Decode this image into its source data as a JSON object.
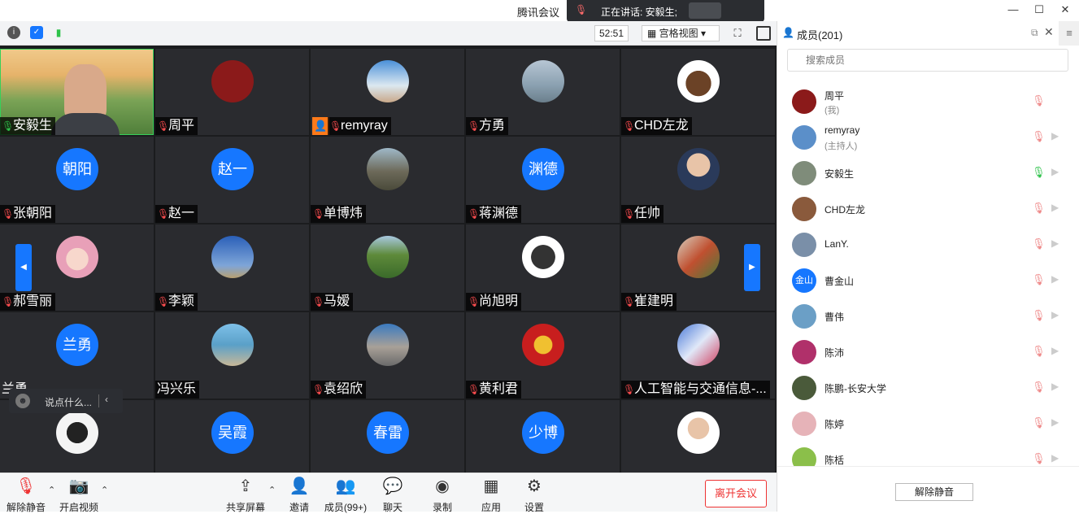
{
  "app": {
    "title": "腾讯会议"
  },
  "speaking": {
    "text": "正在讲话: 安毅生;"
  },
  "window": {
    "minimize": "—",
    "maximize": "☐",
    "close": "✕"
  },
  "toolbar": {
    "timer": "52:51",
    "view_label": "宫格视图"
  },
  "tiles": [
    {
      "name": "安毅生",
      "mic": "on"
    },
    {
      "name": "周平",
      "mic": "off"
    },
    {
      "name": "remyray",
      "mic": "off"
    },
    {
      "name": "方勇",
      "mic": "off"
    },
    {
      "name": "CHD左龙",
      "mic": "off"
    },
    {
      "name": "张朝阳",
      "avatar": "朝阳",
      "mic": "off"
    },
    {
      "name": "赵一",
      "avatar": "赵一",
      "mic": "off"
    },
    {
      "name": "单博炜",
      "mic": "off"
    },
    {
      "name": "蒋渊德",
      "avatar": "渊德",
      "mic": "off"
    },
    {
      "name": "任帅",
      "mic": "off"
    },
    {
      "name": "郝雪丽",
      "mic": "off"
    },
    {
      "name": "李颖",
      "mic": "off"
    },
    {
      "name": "马嫒",
      "mic": "off"
    },
    {
      "name": "尚旭明",
      "mic": "off"
    },
    {
      "name": "崔建明",
      "mic": "off"
    },
    {
      "name": "兰勇",
      "avatar": "兰勇",
      "mic": ""
    },
    {
      "name": "冯兴乐",
      "mic": ""
    },
    {
      "name": "袁绍欣",
      "mic": "off"
    },
    {
      "name": "黄利君",
      "mic": "off"
    },
    {
      "name": "人工智能与交通信息-...",
      "mic": "off"
    },
    {
      "name": "",
      "mic": ""
    },
    {
      "name": "",
      "avatar": "吴霞",
      "mic": ""
    },
    {
      "name": "",
      "avatar": "春雷",
      "mic": ""
    },
    {
      "name": "",
      "avatar": "少博",
      "mic": ""
    },
    {
      "name": "",
      "mic": ""
    }
  ],
  "chat": {
    "placeholder": "说点什么..."
  },
  "bottombar": {
    "unmute": "解除静音",
    "video": "开启视频",
    "share": "共享屏幕",
    "invite": "邀请",
    "members": "成员(99+)",
    "chat": "聊天",
    "record": "录制",
    "apps": "应用",
    "settings": "设置",
    "leave": "离开会议"
  },
  "panel": {
    "title": "成员(201)",
    "search_placeholder": "搜索成员",
    "unmute_all": "解除静音",
    "members": [
      {
        "name": "周平",
        "sub": "(我)",
        "mic": "off",
        "color": "#8b1a1a"
      },
      {
        "name": "remyray",
        "sub": "(主持人)",
        "mic": "off",
        "color": "#5b8fc9"
      },
      {
        "name": "安毅生",
        "sub": "",
        "mic": "on",
        "color": "#7f8c7a"
      },
      {
        "name": "CHD左龙",
        "sub": "",
        "mic": "off",
        "color": "#8a5a3c"
      },
      {
        "name": "LanY.",
        "sub": "",
        "mic": "off",
        "color": "#7a8fa8"
      },
      {
        "name": "曹金山",
        "sub": "",
        "mic": "off",
        "avatar": "金山",
        "color": "#1677ff"
      },
      {
        "name": "曹伟",
        "sub": "",
        "mic": "off",
        "color": "#6b9fc6"
      },
      {
        "name": "陈沛",
        "sub": "",
        "mic": "off",
        "color": "#b0306a"
      },
      {
        "name": "陈鹏-长安大学",
        "sub": "",
        "mic": "off",
        "color": "#4a5a3a"
      },
      {
        "name": "陈婷",
        "sub": "",
        "mic": "off",
        "color": "#e6b3b8"
      },
      {
        "name": "陈栝",
        "sub": "",
        "mic": "off",
        "color": "#8bbf4a"
      }
    ]
  }
}
